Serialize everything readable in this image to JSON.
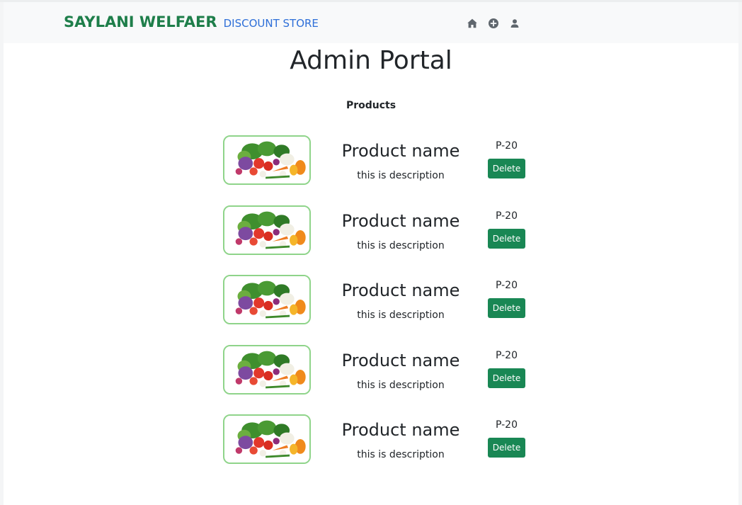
{
  "navbar": {
    "brand_main": "SAYLANI WELFAER",
    "brand_sub": "DISCOUNT STORE",
    "icons": [
      "home-icon",
      "add-circle-icon",
      "user-icon"
    ]
  },
  "page": {
    "title": "Admin Portal",
    "subtitle": "Products"
  },
  "products": [
    {
      "name": "Product name",
      "description": "this is description",
      "price": "P-20",
      "delete_label": "Delete"
    },
    {
      "name": "Product name",
      "description": "this is description",
      "price": "P-20",
      "delete_label": "Delete"
    },
    {
      "name": "Product name",
      "description": "this is description",
      "price": "P-20",
      "delete_label": "Delete"
    },
    {
      "name": "Product name",
      "description": "this is description",
      "price": "P-20",
      "delete_label": "Delete"
    },
    {
      "name": "Product name",
      "description": "this is description",
      "price": "P-20",
      "delete_label": "Delete"
    }
  ],
  "colors": {
    "brand_green": "#1e7e4a",
    "brand_blue": "#2e6fd8",
    "button_green": "#198754",
    "thumb_border": "#8fd48a",
    "navbar_bg": "#f8f9fa"
  }
}
